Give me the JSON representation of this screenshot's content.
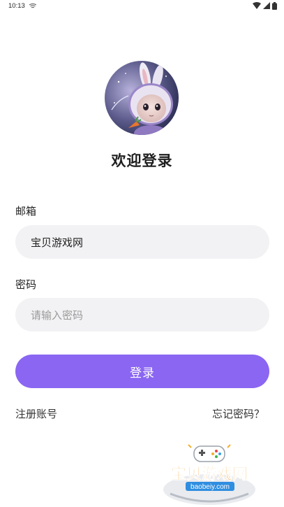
{
  "status_bar": {
    "time": "10:13"
  },
  "page": {
    "title": "欢迎登录"
  },
  "email": {
    "label": "邮箱",
    "value": "宝贝游戏网"
  },
  "password": {
    "label": "密码",
    "placeholder": "请输入密码"
  },
  "login_button": {
    "label": "登录"
  },
  "links": {
    "register": "注册账号",
    "forgot": "忘记密码？"
  },
  "watermark": {
    "brand": "宝贝游戏网",
    "domain": "baobeiy.com"
  },
  "colors": {
    "accent": "#8a66f2",
    "input_bg": "#f2f2f4"
  },
  "icons": [
    "cast-icon",
    "wifi-icon",
    "signal-icon",
    "battery-icon"
  ]
}
